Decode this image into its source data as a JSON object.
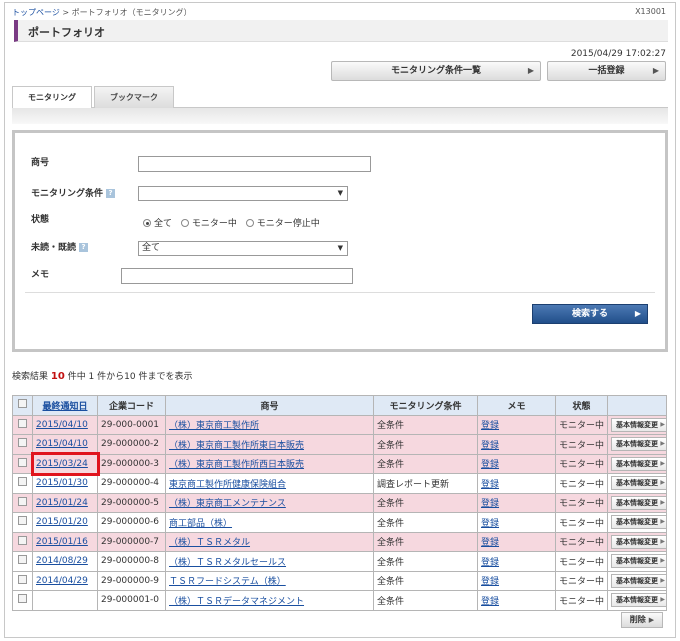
{
  "breadcrumb": {
    "home": "トップページ",
    "separator": ">",
    "current": "ポートフォリオ（モニタリング）"
  },
  "screen_id": "X13001",
  "page_title": "ポートフォリオ",
  "datetime": "2015/04/29 17:02:27",
  "buttons": {
    "monitoring_list": "モニタリング条件一覧",
    "bulk_register": "一括登録",
    "search": "検索する",
    "delete": "削除"
  },
  "tabs": [
    {
      "label": "モニタリング"
    },
    {
      "label": "ブックマーク"
    }
  ],
  "form": {
    "trade_name_label": "商号",
    "trade_name_value": "",
    "condition_label": "モニタリング条件",
    "condition_value": "",
    "status_label": "状態",
    "status_options": [
      "全て",
      "モニター中",
      "モニター停止中"
    ],
    "status_selected": "全て",
    "read_label": "未読・既読",
    "read_value": "全て",
    "memo_label": "メモ",
    "memo_value": ""
  },
  "result_summary": {
    "prefix": "検索結果",
    "count": "10",
    "suffix": "件中 1 件から10 件までを表示"
  },
  "table": {
    "headers": [
      "",
      "最終通知日",
      "企業コード",
      "商号",
      "モニタリング条件",
      "メモ",
      "状態",
      ""
    ],
    "rows": [
      {
        "date": "2015/04/10",
        "code": "29-000-0001",
        "name": "（株）東京商工製作所",
        "condition": "全条件",
        "memo": "登録",
        "status": "モニター中",
        "action": "基本情報変更",
        "tone": "pink"
      },
      {
        "date": "2015/04/10",
        "code": "29-000000-2",
        "name": "（株）東京商工製作所東日本販売",
        "condition": "全条件",
        "memo": "登録",
        "status": "モニター中",
        "action": "基本情報変更",
        "tone": "pink"
      },
      {
        "date": "2015/03/24",
        "code": "29-000000-3",
        "name": "（株）東京商工製作所西日本販売",
        "condition": "全条件",
        "memo": "登録",
        "status": "モニター中",
        "action": "基本情報変更",
        "tone": "pink"
      },
      {
        "date": "2015/01/30",
        "code": "29-000000-4",
        "name": "東京商工製作所健康保険組合",
        "condition": "調査レポート更新",
        "memo": "登録",
        "status": "モニター中",
        "action": "基本情報変更",
        "tone": "white"
      },
      {
        "date": "2015/01/24",
        "code": "29-000000-5",
        "name": "（株）東京商工メンテナンス",
        "condition": "全条件",
        "memo": "登録",
        "status": "モニター中",
        "action": "基本情報変更",
        "tone": "pink"
      },
      {
        "date": "2015/01/20",
        "code": "29-000000-6",
        "name": "商工部品（株）",
        "condition": "全条件",
        "memo": "登録",
        "status": "モニター中",
        "action": "基本情報変更",
        "tone": "white"
      },
      {
        "date": "2015/01/16",
        "code": "29-000000-7",
        "name": "（株）ＴＳＲメタル",
        "condition": "全条件",
        "memo": "登録",
        "status": "モニター中",
        "action": "基本情報変更",
        "tone": "pink"
      },
      {
        "date": "2014/08/29",
        "code": "29-000000-8",
        "name": "（株）ＴＳＲメタルセールス",
        "condition": "全条件",
        "memo": "登録",
        "status": "モニター中",
        "action": "基本情報変更",
        "tone": "white"
      },
      {
        "date": "2014/04/29",
        "code": "29-000000-9",
        "name": "ＴＳＲフードシステム（株）",
        "condition": "全条件",
        "memo": "登録",
        "status": "モニター中",
        "action": "基本情報変更",
        "tone": "white"
      },
      {
        "date": "",
        "code": "29-000001-0",
        "name": "（株）ＴＳＲデータマネジメント",
        "condition": "全条件",
        "memo": "登録",
        "status": "モニター中",
        "action": "基本情報変更",
        "tone": "white"
      }
    ]
  },
  "colors": {
    "accent": "#7a3b84",
    "link": "#1a4fa0",
    "pink_row": "#f6d8df",
    "header_bg": "#dfe9f5",
    "highlight": "#e0141e",
    "count": "#c21010"
  }
}
